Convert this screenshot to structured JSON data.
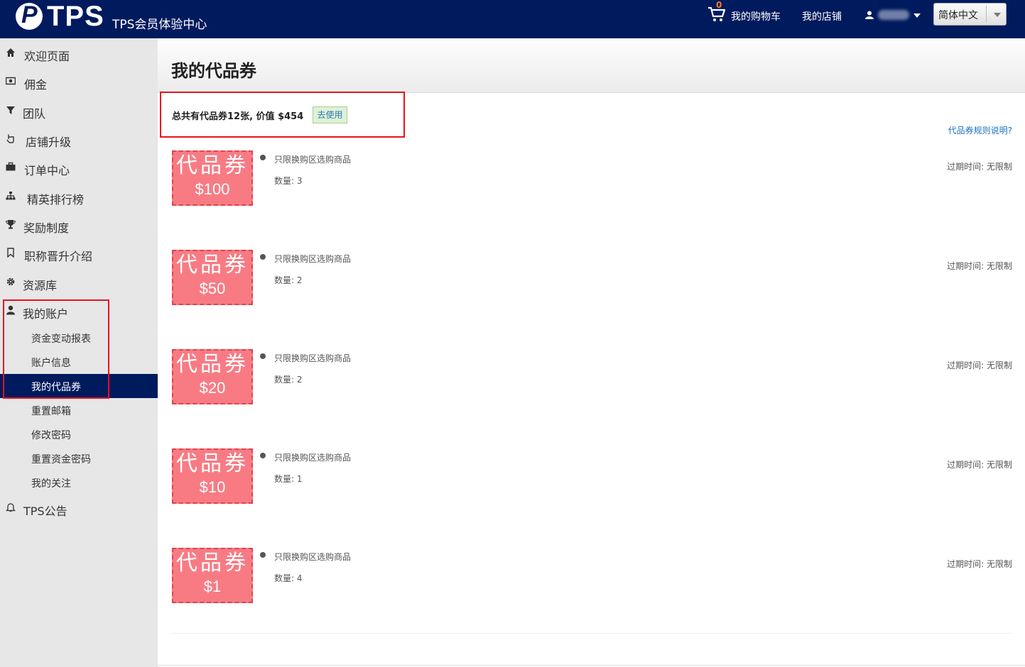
{
  "header": {
    "logo_text": "TPS",
    "logo_subtitle": "TPS会员体验中心",
    "cart_count": "0",
    "cart_label": "我的购物车",
    "store_label": "我的店铺",
    "language": "简体中文"
  },
  "sidebar": {
    "items": [
      {
        "label": "欢迎页面",
        "icon": "home-icon"
      },
      {
        "label": "佣金",
        "icon": "money-icon"
      },
      {
        "label": "团队",
        "icon": "filter-icon"
      },
      {
        "label": "店铺升级",
        "icon": "hand-pointer-icon"
      },
      {
        "label": "订单中心",
        "icon": "briefcase-icon"
      },
      {
        "label": "精英排行榜",
        "icon": "sitemap-icon"
      },
      {
        "label": "奖励制度",
        "icon": "trophy-icon"
      },
      {
        "label": "职称晋升介绍",
        "icon": "bookmark-icon"
      },
      {
        "label": "资源库",
        "icon": "gear-icon"
      },
      {
        "label": "我的账户",
        "icon": "user-icon"
      },
      {
        "label": "TPS公告",
        "icon": "bell-icon"
      }
    ],
    "account_sub": [
      {
        "label": "资金变动报表"
      },
      {
        "label": "账户信息"
      },
      {
        "label": "我的代品券",
        "active": true
      },
      {
        "label": "重置邮箱"
      },
      {
        "label": "修改密码"
      },
      {
        "label": "重置资金密码"
      },
      {
        "label": "我的关注"
      }
    ]
  },
  "main": {
    "title": "我的代品券",
    "summary": "总共有代品券12张, 价值 $454",
    "use_button": "去使用",
    "rules_link": "代品券规则说明?",
    "vouchers": [
      {
        "title": "代品券",
        "value": "$100",
        "desc": "只限换购区选购商品",
        "qty": "数量: 3",
        "expire": "过期时间: 无限制"
      },
      {
        "title": "代品券",
        "value": "$50",
        "desc": "只限换购区选购商品",
        "qty": "数量: 2",
        "expire": "过期时间: 无限制"
      },
      {
        "title": "代品券",
        "value": "$20",
        "desc": "只限换购区选购商品",
        "qty": "数量: 2",
        "expire": "过期时间: 无限制"
      },
      {
        "title": "代品券",
        "value": "$10",
        "desc": "只限换购区选购商品",
        "qty": "数量: 1",
        "expire": "过期时间: 无限制"
      },
      {
        "title": "代品券",
        "value": "$1",
        "desc": "只限换购区选购商品",
        "qty": "数量: 4",
        "expire": "过期时间: 无限制"
      }
    ]
  },
  "colors": {
    "header_bg": "#001a5e",
    "voucher_bg": "#f87b84",
    "highlight_border": "#e8131d",
    "cart_count": "#ff7a1a"
  }
}
